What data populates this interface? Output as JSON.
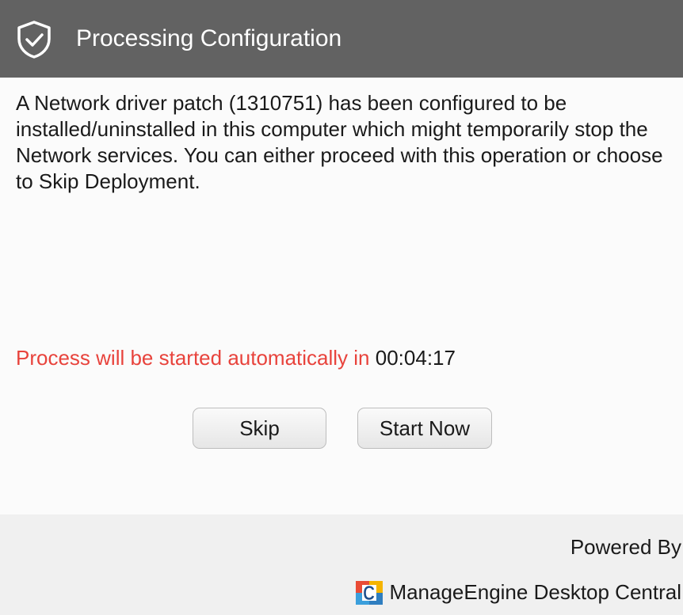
{
  "window": {
    "title": "Processing Configuration",
    "title_icon": "shield-check-icon"
  },
  "message": {
    "text": "A Network driver patch (1310751) has been configured to be installed/uninstalled in this computer which might temporarily stop the Network services. You can either proceed with this operation or choose to Skip Deployment."
  },
  "countdown": {
    "label": "Process will be started automatically in",
    "time": "00:04:17",
    "label_color": "#e8433c"
  },
  "buttons": {
    "skip_label": "Skip",
    "start_label": "Start Now"
  },
  "footer": {
    "powered_by": "Powered By",
    "brand_name": "ManageEngine Desktop Central",
    "brand_logo": "desktop-central-logo-icon"
  },
  "colors": {
    "titlebar_bg": "#626262",
    "body_bg": "#fbfbfb",
    "footer_bg": "#f0f0f0"
  }
}
